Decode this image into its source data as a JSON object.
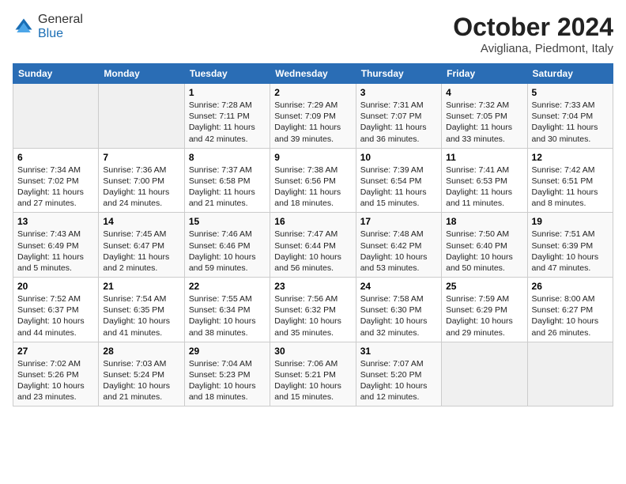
{
  "logo": {
    "general": "General",
    "blue": "Blue"
  },
  "title": "October 2024",
  "location": "Avigliana, Piedmont, Italy",
  "days_header": [
    "Sunday",
    "Monday",
    "Tuesday",
    "Wednesday",
    "Thursday",
    "Friday",
    "Saturday"
  ],
  "weeks": [
    [
      {
        "day": "",
        "sunrise": "",
        "sunset": "",
        "daylight": ""
      },
      {
        "day": "",
        "sunrise": "",
        "sunset": "",
        "daylight": ""
      },
      {
        "day": "1",
        "sunrise": "Sunrise: 7:28 AM",
        "sunset": "Sunset: 7:11 PM",
        "daylight": "Daylight: 11 hours and 42 minutes."
      },
      {
        "day": "2",
        "sunrise": "Sunrise: 7:29 AM",
        "sunset": "Sunset: 7:09 PM",
        "daylight": "Daylight: 11 hours and 39 minutes."
      },
      {
        "day": "3",
        "sunrise": "Sunrise: 7:31 AM",
        "sunset": "Sunset: 7:07 PM",
        "daylight": "Daylight: 11 hours and 36 minutes."
      },
      {
        "day": "4",
        "sunrise": "Sunrise: 7:32 AM",
        "sunset": "Sunset: 7:05 PM",
        "daylight": "Daylight: 11 hours and 33 minutes."
      },
      {
        "day": "5",
        "sunrise": "Sunrise: 7:33 AM",
        "sunset": "Sunset: 7:04 PM",
        "daylight": "Daylight: 11 hours and 30 minutes."
      }
    ],
    [
      {
        "day": "6",
        "sunrise": "Sunrise: 7:34 AM",
        "sunset": "Sunset: 7:02 PM",
        "daylight": "Daylight: 11 hours and 27 minutes."
      },
      {
        "day": "7",
        "sunrise": "Sunrise: 7:36 AM",
        "sunset": "Sunset: 7:00 PM",
        "daylight": "Daylight: 11 hours and 24 minutes."
      },
      {
        "day": "8",
        "sunrise": "Sunrise: 7:37 AM",
        "sunset": "Sunset: 6:58 PM",
        "daylight": "Daylight: 11 hours and 21 minutes."
      },
      {
        "day": "9",
        "sunrise": "Sunrise: 7:38 AM",
        "sunset": "Sunset: 6:56 PM",
        "daylight": "Daylight: 11 hours and 18 minutes."
      },
      {
        "day": "10",
        "sunrise": "Sunrise: 7:39 AM",
        "sunset": "Sunset: 6:54 PM",
        "daylight": "Daylight: 11 hours and 15 minutes."
      },
      {
        "day": "11",
        "sunrise": "Sunrise: 7:41 AM",
        "sunset": "Sunset: 6:53 PM",
        "daylight": "Daylight: 11 hours and 11 minutes."
      },
      {
        "day": "12",
        "sunrise": "Sunrise: 7:42 AM",
        "sunset": "Sunset: 6:51 PM",
        "daylight": "Daylight: 11 hours and 8 minutes."
      }
    ],
    [
      {
        "day": "13",
        "sunrise": "Sunrise: 7:43 AM",
        "sunset": "Sunset: 6:49 PM",
        "daylight": "Daylight: 11 hours and 5 minutes."
      },
      {
        "day": "14",
        "sunrise": "Sunrise: 7:45 AM",
        "sunset": "Sunset: 6:47 PM",
        "daylight": "Daylight: 11 hours and 2 minutes."
      },
      {
        "day": "15",
        "sunrise": "Sunrise: 7:46 AM",
        "sunset": "Sunset: 6:46 PM",
        "daylight": "Daylight: 10 hours and 59 minutes."
      },
      {
        "day": "16",
        "sunrise": "Sunrise: 7:47 AM",
        "sunset": "Sunset: 6:44 PM",
        "daylight": "Daylight: 10 hours and 56 minutes."
      },
      {
        "day": "17",
        "sunrise": "Sunrise: 7:48 AM",
        "sunset": "Sunset: 6:42 PM",
        "daylight": "Daylight: 10 hours and 53 minutes."
      },
      {
        "day": "18",
        "sunrise": "Sunrise: 7:50 AM",
        "sunset": "Sunset: 6:40 PM",
        "daylight": "Daylight: 10 hours and 50 minutes."
      },
      {
        "day": "19",
        "sunrise": "Sunrise: 7:51 AM",
        "sunset": "Sunset: 6:39 PM",
        "daylight": "Daylight: 10 hours and 47 minutes."
      }
    ],
    [
      {
        "day": "20",
        "sunrise": "Sunrise: 7:52 AM",
        "sunset": "Sunset: 6:37 PM",
        "daylight": "Daylight: 10 hours and 44 minutes."
      },
      {
        "day": "21",
        "sunrise": "Sunrise: 7:54 AM",
        "sunset": "Sunset: 6:35 PM",
        "daylight": "Daylight: 10 hours and 41 minutes."
      },
      {
        "day": "22",
        "sunrise": "Sunrise: 7:55 AM",
        "sunset": "Sunset: 6:34 PM",
        "daylight": "Daylight: 10 hours and 38 minutes."
      },
      {
        "day": "23",
        "sunrise": "Sunrise: 7:56 AM",
        "sunset": "Sunset: 6:32 PM",
        "daylight": "Daylight: 10 hours and 35 minutes."
      },
      {
        "day": "24",
        "sunrise": "Sunrise: 7:58 AM",
        "sunset": "Sunset: 6:30 PM",
        "daylight": "Daylight: 10 hours and 32 minutes."
      },
      {
        "day": "25",
        "sunrise": "Sunrise: 7:59 AM",
        "sunset": "Sunset: 6:29 PM",
        "daylight": "Daylight: 10 hours and 29 minutes."
      },
      {
        "day": "26",
        "sunrise": "Sunrise: 8:00 AM",
        "sunset": "Sunset: 6:27 PM",
        "daylight": "Daylight: 10 hours and 26 minutes."
      }
    ],
    [
      {
        "day": "27",
        "sunrise": "Sunrise: 7:02 AM",
        "sunset": "Sunset: 5:26 PM",
        "daylight": "Daylight: 10 hours and 23 minutes."
      },
      {
        "day": "28",
        "sunrise": "Sunrise: 7:03 AM",
        "sunset": "Sunset: 5:24 PM",
        "daylight": "Daylight: 10 hours and 21 minutes."
      },
      {
        "day": "29",
        "sunrise": "Sunrise: 7:04 AM",
        "sunset": "Sunset: 5:23 PM",
        "daylight": "Daylight: 10 hours and 18 minutes."
      },
      {
        "day": "30",
        "sunrise": "Sunrise: 7:06 AM",
        "sunset": "Sunset: 5:21 PM",
        "daylight": "Daylight: 10 hours and 15 minutes."
      },
      {
        "day": "31",
        "sunrise": "Sunrise: 7:07 AM",
        "sunset": "Sunset: 5:20 PM",
        "daylight": "Daylight: 10 hours and 12 minutes."
      },
      {
        "day": "",
        "sunrise": "",
        "sunset": "",
        "daylight": ""
      },
      {
        "day": "",
        "sunrise": "",
        "sunset": "",
        "daylight": ""
      }
    ]
  ]
}
